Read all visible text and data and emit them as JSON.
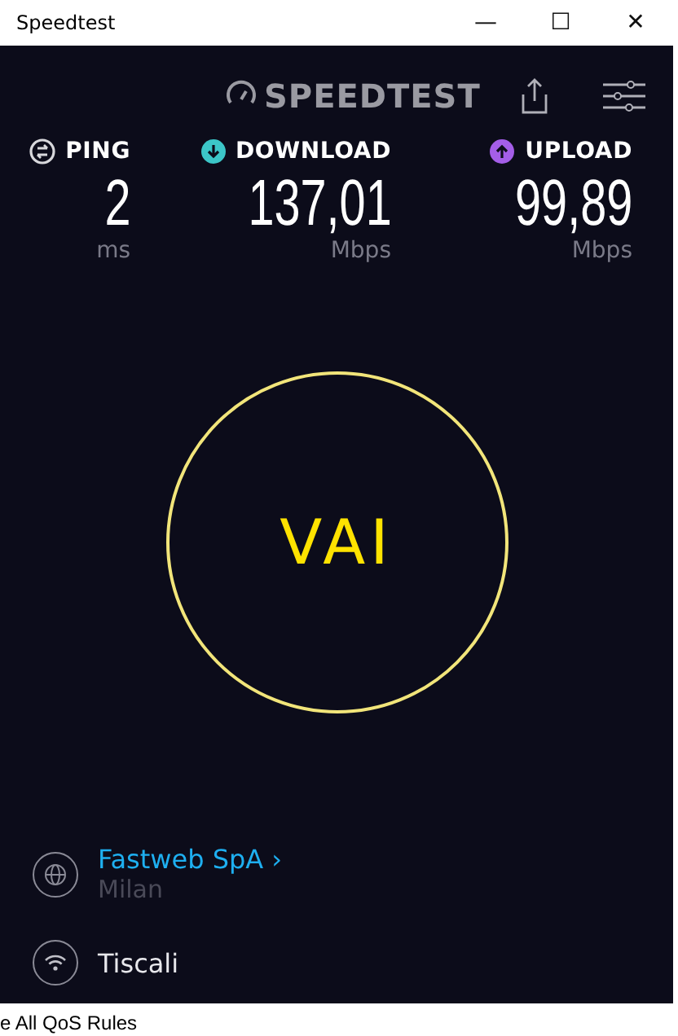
{
  "window": {
    "title": "Speedtest",
    "controls": [
      "—",
      "☐",
      "✕"
    ]
  },
  "header": {
    "logo": "SPEEDTEST"
  },
  "metrics": [
    {
      "label": "PING",
      "value": "2",
      "unit": "ms",
      "color": "#d8d8dc",
      "kind": "ping"
    },
    {
      "label": "DOWNLOAD",
      "value": "137,01",
      "unit": "Mbps",
      "color": "#3cc6c8",
      "kind": "download"
    },
    {
      "label": "UPLOAD",
      "value": "99,89",
      "unit": "Mbps",
      "color": "#a45ee8",
      "kind": "upload"
    }
  ],
  "go_button": {
    "label": "VAI"
  },
  "server": {
    "name": "Fastweb SpA",
    "chevron": "›",
    "location": "Milan"
  },
  "connection": {
    "name": "Tiscali"
  },
  "background_window": {
    "text": "e All QoS Rules"
  }
}
